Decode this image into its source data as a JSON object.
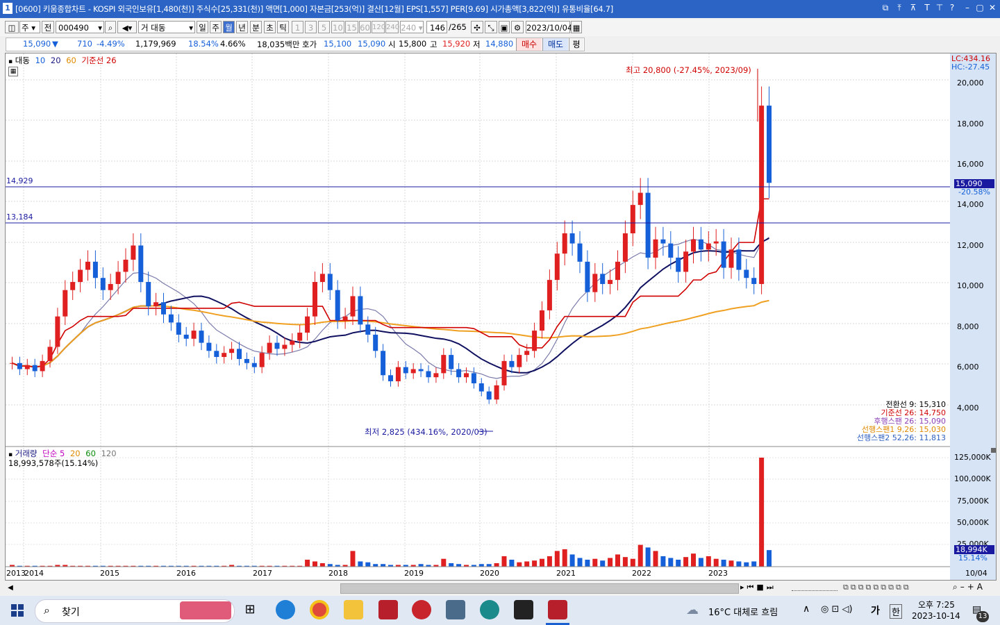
{
  "titlebar": {
    "app_no": "1",
    "title": "[0600] 키움종합차트 - KOSPI 외국인보유[1,480(천)] 주식수[25,331(천)] 액면[1,000] 자본금[253(억)] 결산[12월] EPS[1,557] PER[9.69] 시가총액[3,822(억)] 유통비율[64.7]"
  },
  "toolbar": {
    "market": "주",
    "all": "전",
    "code": "000490",
    "stock_name": "대동",
    "periods": [
      "일",
      "주",
      "월",
      "년",
      "분",
      "초",
      "틱"
    ],
    "selected_period": "월",
    "intervals": [
      "1",
      "3",
      "5",
      "10",
      "15",
      "60",
      "120",
      "240"
    ],
    "interval_select": "240",
    "count": "146",
    "total": "/265",
    "date": "2023/10/04"
  },
  "quote": {
    "price": "15,090",
    "change": "710",
    "change_pct": "-4.49%",
    "volume": "1,179,969",
    "volume_pct": "18.54%",
    "turnover": "4.66%",
    "amount": "18,035백만",
    "ask_label": "호가",
    "ask": "15,100",
    "bid": "15,090",
    "open_label": "시",
    "open": "15,800",
    "high_label": "고",
    "high": "15,920",
    "low_label": "저",
    "low": "14,880",
    "buy": "매수",
    "sell": "매도",
    "eval": "평"
  },
  "price_panel": {
    "legend": [
      "대동",
      "10",
      "20",
      "60",
      "기준선 26"
    ],
    "lc": "LC:434.16",
    "hc": "HC:-27.45",
    "high_note": "최고 20,800 (-27.45%, 2023/09)",
    "low_note": "최저 2,825 (434.16%, 2020/03)",
    "hline1": "14,929",
    "hline2": "13,184",
    "price_tag": "15,090",
    "price_tag_pct": "-20.58%",
    "y_ticks": [
      "20,000",
      "18,000",
      "16,000",
      "14,000",
      "12,000",
      "10,000",
      "8,000",
      "6,000",
      "4,000"
    ],
    "ichimoku": [
      {
        "text": "전환선 9: 15,310",
        "color": "#000000"
      },
      {
        "text": "기준선 26: 14,750",
        "color": "#d00000"
      },
      {
        "text": "후행스팬 26: 15,090",
        "color": "#8b3fb5"
      },
      {
        "text": "선행스팬1 9,26: 15,030",
        "color": "#e08a00"
      },
      {
        "text": "선행스팬2 52,26: 11,813",
        "color": "#3060c0"
      }
    ]
  },
  "volume_panel": {
    "legend": [
      "거래량",
      "단순 5",
      "20",
      "60",
      "120"
    ],
    "last_volume": "18,993,578주(15.14%)",
    "y_ticks": [
      "125,000K",
      "100,000K",
      "75,000K",
      "50,000K",
      "25,000K"
    ],
    "tag": "18,994K",
    "tag_pct": "15.14%"
  },
  "x_axis": [
    "2013",
    "2014",
    "2015",
    "2016",
    "2017",
    "2018",
    "2019",
    "2020",
    "2021",
    "2022",
    "2023",
    "10/04"
  ],
  "taskbar": {
    "search": "찾기",
    "weather": "16°C 대체로 흐림",
    "ime": "가",
    "lang": "한",
    "time": "오후 7:25",
    "date": "2023-10-14",
    "notif": "13"
  },
  "colors": {
    "up": "#e02020",
    "down": "#1560d8",
    "accent": "#2b64c4"
  }
}
